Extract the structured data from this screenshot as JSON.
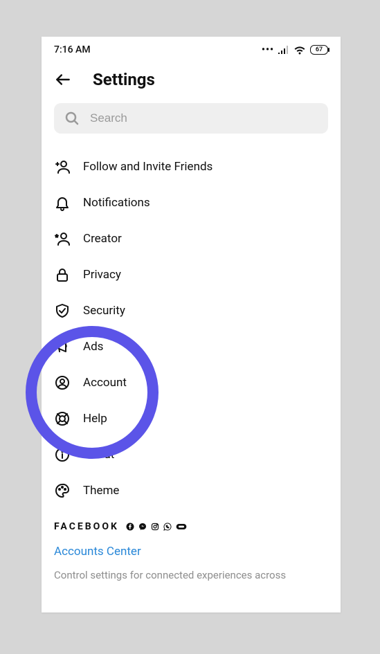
{
  "statusbar": {
    "time": "7:16 AM",
    "battery": "67"
  },
  "header": {
    "title": "Settings"
  },
  "search": {
    "placeholder": "Search"
  },
  "menu": {
    "items": [
      {
        "label": "Follow and Invite Friends"
      },
      {
        "label": "Notifications"
      },
      {
        "label": "Creator"
      },
      {
        "label": "Privacy"
      },
      {
        "label": "Security"
      },
      {
        "label": "Ads"
      },
      {
        "label": "Account"
      },
      {
        "label": "Help"
      },
      {
        "label": "About"
      },
      {
        "label": "Theme"
      }
    ]
  },
  "footer": {
    "company": "FACEBOOK",
    "link": "Accounts Center",
    "desc": "Control settings for connected experiences across"
  }
}
